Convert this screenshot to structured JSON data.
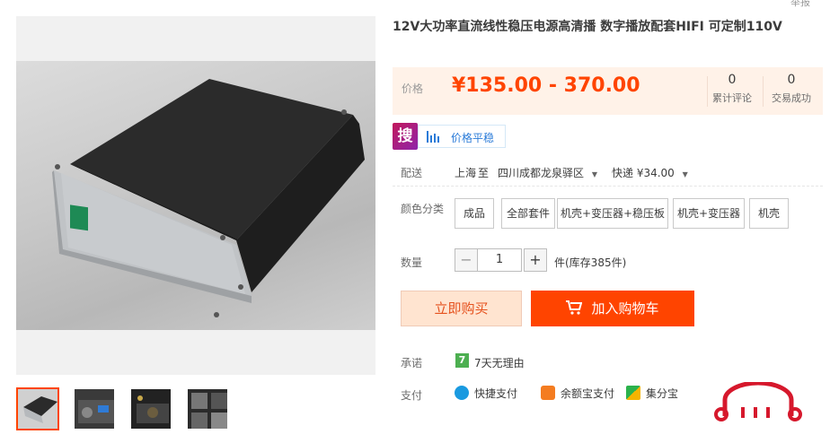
{
  "header": {
    "report_label": "举报"
  },
  "product": {
    "title": "12V大功率直流线性稳压电源高清播 数字播放配套HIFI 可定制110V",
    "price_label": "价格",
    "price": "¥135.00 - 370.00",
    "reviews_count": "0",
    "reviews_label": "累计评论",
    "sales_count": "0",
    "sales_label": "交易成功"
  },
  "badges": {
    "sou": "搜",
    "stable_label": "价格平稳"
  },
  "shipping": {
    "label": "配送",
    "from": "上海",
    "to_word": "至",
    "destination": "四川成都龙泉驿区",
    "method": "快递 ¥34.00"
  },
  "options": {
    "label": "颜色分类",
    "items": [
      "成品",
      "全部套件",
      "机壳+变压器+稳压板",
      "机壳+变压器",
      "机壳"
    ]
  },
  "quantity": {
    "label": "数量",
    "minus": "−",
    "value": "1",
    "plus": "+",
    "stock_text": "件(库存385件)"
  },
  "actions": {
    "buy_now": "立即购买",
    "add_to_cart": "加入购物车"
  },
  "promise": {
    "label": "承诺",
    "badge": "7",
    "text": "7天无理由"
  },
  "payment": {
    "label": "支付",
    "methods": [
      "快捷支付",
      "余额宝支付",
      "集分宝"
    ]
  },
  "colors": {
    "accent": "#ff4400",
    "price": "#ff4400",
    "price_bg": "#fff2e8",
    "link_blue": "#2a7bd8"
  }
}
